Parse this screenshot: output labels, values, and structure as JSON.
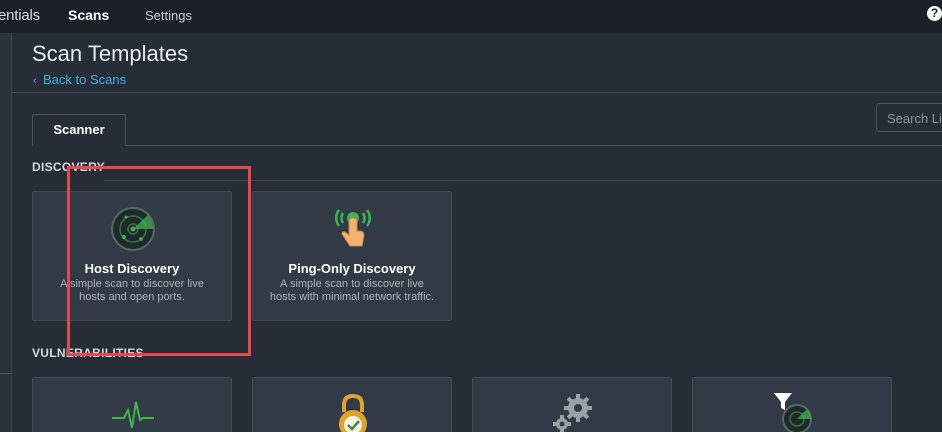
{
  "topbar": {
    "brand": "entials",
    "nav_scans": "Scans",
    "nav_settings": "Settings",
    "help": "?"
  },
  "header": {
    "title": "Scan Templates",
    "back_link": "Back to Scans"
  },
  "search": {
    "placeholder": "Search Li"
  },
  "tabs": {
    "scanner": "Scanner"
  },
  "sections": {
    "discovery": "DISCOVERY",
    "vulnerabilities": "VULNERABILITIES"
  },
  "discovery_cards": [
    {
      "title": "Host Discovery",
      "description": "A simple scan to discover live hosts and open ports.",
      "icon": "radar-icon"
    },
    {
      "title": "Ping-Only Discovery",
      "description": "A simple scan to discover live hosts with minimal network traffic.",
      "icon": "ping-hand-icon"
    }
  ],
  "vulnerability_cards": [
    {
      "icon": "heartbeat-icon"
    },
    {
      "icon": "padlock-check-icon"
    },
    {
      "icon": "gears-icon"
    },
    {
      "icon": "radar-filter-icon"
    }
  ],
  "colors": {
    "topbar_bg": "#1b2028",
    "page_bg": "#262d37",
    "card_bg": "#323a45",
    "link": "#3fb0e0",
    "accent_green": "#3fb34f",
    "highlight_red": "#e5484d"
  }
}
